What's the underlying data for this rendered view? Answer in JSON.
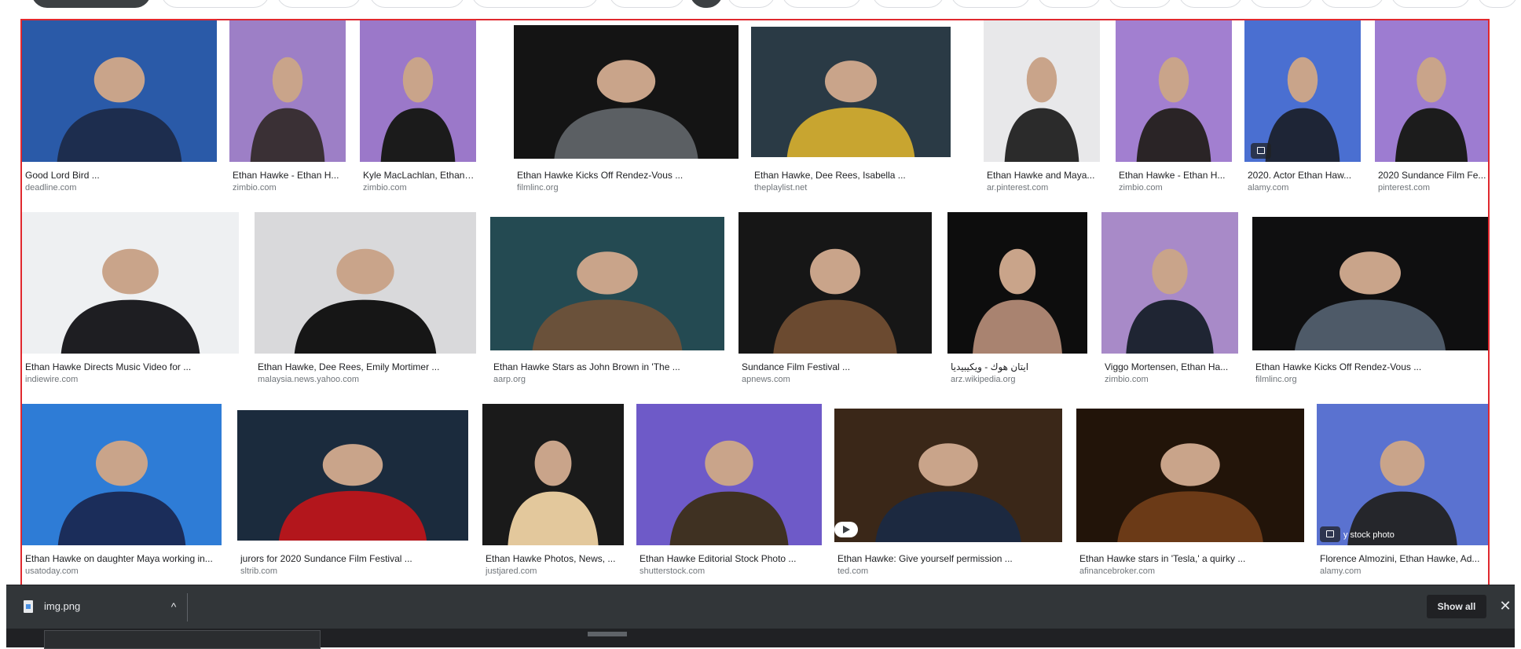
{
  "results": [
    [
      {
        "title": "Good Lord Bird ...",
        "source": "deadline.com",
        "bg": "#2a5aa8",
        "fg": "#1d2d4e"
      },
      {
        "title": "Ethan Hawke - Ethan H...",
        "source": "zimbio.com",
        "bg": "#9d7fc6",
        "fg": "#3a3035"
      },
      {
        "title": "Kyle MacLachlan, Ethan Ha...",
        "source": "zimbio.com",
        "bg": "#9b78c9",
        "fg": "#1b1b1b"
      },
      {
        "title": "Ethan Hawke Kicks Off Rendez-Vous ...",
        "source": "filmlinc.org",
        "bg": "#141414",
        "fg": "#5b5f63"
      },
      {
        "title": "Ethan Hawke, Dee Rees, Isabella ...",
        "source": "theplaylist.net",
        "bg": "#2a3a45",
        "fg": "#c8a530"
      },
      {
        "title": "Ethan Hawke and Maya...",
        "source": "ar.pinterest.com",
        "bg": "#e8e8ea",
        "fg": "#2b2b2b"
      },
      {
        "title": "Ethan Hawke - Ethan H...",
        "source": "zimbio.com",
        "bg": "#a27fd0",
        "fg": "#2a2426"
      },
      {
        "title": "2020. Actor Ethan Haw...",
        "source": "alamy.com",
        "bg": "#4a6fd1",
        "fg": "#1e2536"
      },
      {
        "title": "2020 Sundance Film Fe...",
        "source": "pinterest.com",
        "bg": "#9d7cd1",
        "fg": "#1c1c1c"
      }
    ],
    [
      {
        "title": "Ethan Hawke Directs Music Video for ...",
        "source": "indiewire.com",
        "bg": "#eef0f2",
        "fg": "#1e1e22"
      },
      {
        "title": "Ethan Hawke, Dee Rees, Emily Mortimer ...",
        "source": "malaysia.news.yahoo.com",
        "bg": "#d9d9db",
        "fg": "#161616"
      },
      {
        "title": "Ethan Hawke Stars as John Brown in 'The ...",
        "source": "aarp.org",
        "bg": "#244a52",
        "fg": "#6a513a"
      },
      {
        "title": "Sundance Film Festival ...",
        "source": "apnews.com",
        "bg": "#161616",
        "fg": "#6b4a30"
      },
      {
        "title": "ایتان هوك - ويكيبيديا",
        "source": "arz.wikipedia.org",
        "bg": "#0d0d0d",
        "fg": "#a98370"
      },
      {
        "title": "Viggo Mortensen, Ethan Ha...",
        "source": "zimbio.com",
        "bg": "#a88ac8",
        "fg": "#1f2533"
      },
      {
        "title": "Ethan Hawke Kicks Off Rendez-Vous ...",
        "source": "filmlinc.org",
        "bg": "#0f0f10",
        "fg": "#4e5a68"
      }
    ],
    [
      {
        "title": "Ethan Hawke on daughter Maya working in...",
        "source": "usatoday.com",
        "bg": "#2e7cd6",
        "fg": "#1b2d5a"
      },
      {
        "title": "jurors for 2020 Sundance Film Festival ...",
        "source": "sltrib.com",
        "bg": "#1b2b3d",
        "fg": "#b3161c"
      },
      {
        "title": "Ethan Hawke Photos, News, ...",
        "source": "justjared.com",
        "bg": "#1a1a1a",
        "fg": "#e3c89c"
      },
      {
        "title": "Ethan Hawke Editorial Stock Photo ...",
        "source": "shutterstock.com",
        "bg": "#6e5ac8",
        "fg": "#3f3122"
      },
      {
        "title": "Ethan Hawke: Give yourself permission ...",
        "source": "ted.com",
        "bg": "#3a2718",
        "fg": "#1c2940"
      },
      {
        "title": "Ethan Hawke stars in 'Tesla,' a quirky ...",
        "source": "afinancebroker.com",
        "bg": "#221409",
        "fg": "#6b3a17"
      },
      {
        "title": "Florence Almozini, Ethan Hawke, Ad...",
        "source": "alamy.com",
        "bg": "#5a72d0",
        "fg": "#25262b"
      }
    ]
  ],
  "overlays": {
    "stock_text": "y stock photo"
  },
  "download": {
    "file_name": "img.png",
    "show_all": "Show all",
    "chevron": "^",
    "close": "✕"
  },
  "colors": {
    "outline": "#e0282e",
    "dl_bar": "#323639",
    "caption": "#202124",
    "source": "#70757a"
  }
}
